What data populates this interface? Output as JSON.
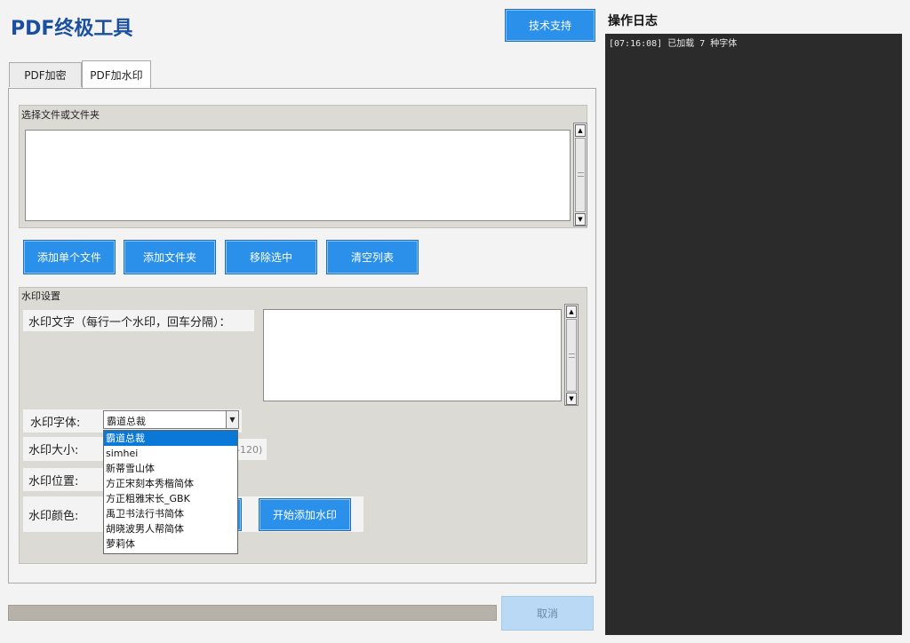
{
  "app": {
    "title": "PDF终极工具"
  },
  "header": {
    "support_button": "技术支持"
  },
  "tabs": [
    {
      "label": "PDF加密",
      "active": false
    },
    {
      "label": "PDF加水印",
      "active": true
    }
  ],
  "file_section": {
    "label": "选择文件或文件夹",
    "buttons": {
      "add_file": "添加单个文件",
      "add_folder": "添加文件夹",
      "remove_selected": "移除选中",
      "clear_list": "清空列表"
    }
  },
  "watermark_section": {
    "label": "水印设置",
    "text_label": "水印文字（每行一个水印，回车分隔）：",
    "text_value": "",
    "font_label": "水印字体:",
    "font_selected": "霸道总裁",
    "font_options": [
      "霸道总裁",
      "simhei",
      "新蒂雪山体",
      "方正宋刻本秀楷简体",
      "方正粗雅宋长_GBK",
      "禹卫书法行书简体",
      "胡晓波男人帮简体",
      "萝莉体"
    ],
    "size_label": "水印大小:",
    "size_hint": "-120)",
    "position_label": "水印位置:",
    "color_label": "水印颜色:",
    "start_button": "开始添加水印"
  },
  "footer": {
    "cancel_button": "取消",
    "progress": 0
  },
  "log": {
    "title": "操作日志",
    "lines": [
      "[07:16:08] 已加载 7 种字体"
    ]
  },
  "colors": {
    "accent": "#2b90ea",
    "title": "#1b4fa0",
    "log_bg": "#2b2b2b"
  }
}
